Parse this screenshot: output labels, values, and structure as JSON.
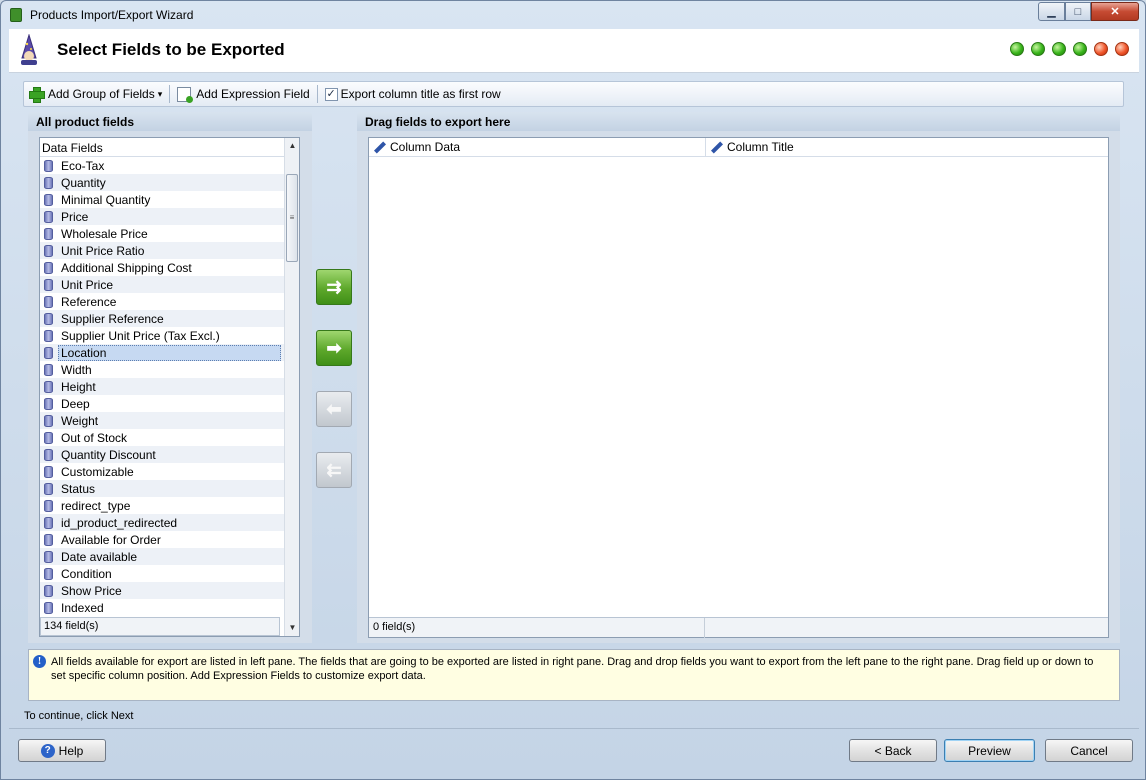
{
  "window": {
    "title": "Products Import/Export Wizard",
    "minimize_glyph": "▁",
    "maximize_glyph": "□",
    "close_glyph": "✕"
  },
  "header": {
    "title": "Select Fields to be Exported",
    "step_dots": [
      "green",
      "green",
      "green",
      "green",
      "red",
      "red"
    ]
  },
  "toolbar": {
    "add_group_label": "Add Group of Fields",
    "add_group_arrow": "▾",
    "add_expression_label": "Add Expression Field",
    "export_title_label": "Export column title as first row",
    "export_title_checked": true,
    "check_glyph": "✓"
  },
  "left_pane": {
    "title": "All product fields",
    "list_header": "Data Fields",
    "items": [
      "Eco-Tax",
      "Quantity",
      "Minimal Quantity",
      "Price",
      "Wholesale Price",
      "Unit Price Ratio",
      "Additional Shipping Cost",
      "Unit Price",
      "Reference",
      "Supplier Reference",
      "Supplier Unit Price (Tax Excl.)",
      "Location",
      "Width",
      "Height",
      "Deep",
      "Weight",
      "Out of Stock",
      "Quantity Discount",
      "Customizable",
      "Status",
      "redirect_type",
      "id_product_redirected",
      "Available for Order",
      "Date available",
      "Condition",
      "Show Price",
      "Indexed"
    ],
    "selected_item": "Location",
    "footer": "134 field(s)",
    "scroll_up_glyph": "▲",
    "scroll_down_glyph": "▼",
    "scroll_thumb_glyph": "≡"
  },
  "move_buttons": {
    "add_all_glyph": "⇉",
    "add_selected_glyph": "➡",
    "remove_selected_glyph": "⬅",
    "remove_all_glyph": "⇇"
  },
  "right_pane": {
    "title": "Drag fields to export here",
    "columns": [
      "Column Data",
      "Column Title"
    ],
    "footer": "0 field(s)"
  },
  "info": {
    "icon_glyph": "!",
    "text": "All fields available for export are listed in left pane. The fields that are going to be exported are listed in right pane. Drag and drop fields you want to export from the left pane to the right pane. Drag field up or down to set specific column position. Add Expression Fields to customize export data."
  },
  "footer": {
    "continue_text": "To continue, click Next",
    "help_label": "Help",
    "help_icon_glyph": "?",
    "back_label": "< Back",
    "preview_label": "Preview",
    "cancel_label": "Cancel"
  }
}
